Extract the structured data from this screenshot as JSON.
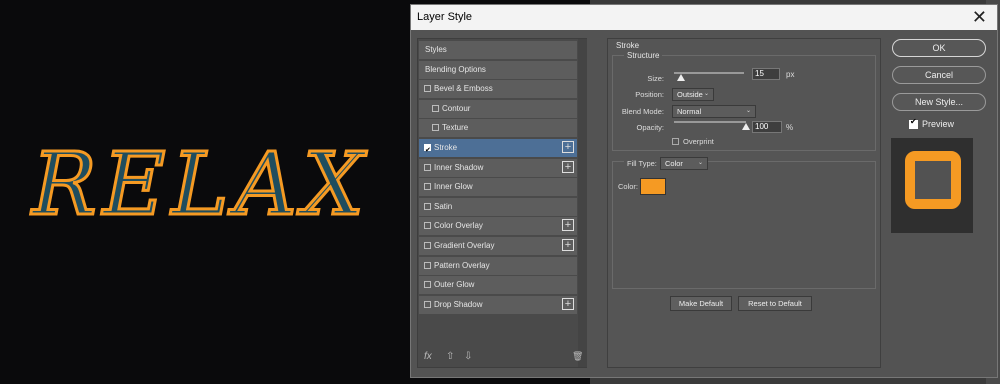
{
  "canvas": {
    "art_text": "RELAX",
    "colors": {
      "fill": "#1f4d5e",
      "stroke": "#f59a23",
      "background": "#0a0a0c"
    }
  },
  "dialog": {
    "title": "Layer Style",
    "close_glyph": "✕"
  },
  "styles_list": [
    {
      "label": "Styles",
      "checkbox": false,
      "plus": false,
      "selected": false,
      "indent": 0
    },
    {
      "label": "Blending Options",
      "checkbox": false,
      "plus": false,
      "selected": false,
      "indent": 0
    },
    {
      "label": "Bevel & Emboss",
      "checkbox": true,
      "checked": false,
      "plus": false,
      "selected": false,
      "indent": 0
    },
    {
      "label": "Contour",
      "checkbox": true,
      "checked": false,
      "plus": false,
      "selected": false,
      "indent": 1
    },
    {
      "label": "Texture",
      "checkbox": true,
      "checked": false,
      "plus": false,
      "selected": false,
      "indent": 1
    },
    {
      "label": "Stroke",
      "checkbox": true,
      "checked": true,
      "plus": true,
      "selected": true,
      "indent": 0
    },
    {
      "label": "Inner Shadow",
      "checkbox": true,
      "checked": false,
      "plus": true,
      "selected": false,
      "indent": 0
    },
    {
      "label": "Inner Glow",
      "checkbox": true,
      "checked": false,
      "plus": false,
      "selected": false,
      "indent": 0
    },
    {
      "label": "Satin",
      "checkbox": true,
      "checked": false,
      "plus": false,
      "selected": false,
      "indent": 0
    },
    {
      "label": "Color Overlay",
      "checkbox": true,
      "checked": false,
      "plus": true,
      "selected": false,
      "indent": 0
    },
    {
      "label": "Gradient Overlay",
      "checkbox": true,
      "checked": false,
      "plus": true,
      "selected": false,
      "indent": 0
    },
    {
      "label": "Pattern Overlay",
      "checkbox": true,
      "checked": false,
      "plus": false,
      "selected": false,
      "indent": 0
    },
    {
      "label": "Outer Glow",
      "checkbox": true,
      "checked": false,
      "plus": false,
      "selected": false,
      "indent": 0
    },
    {
      "label": "Drop Shadow",
      "checkbox": true,
      "checked": false,
      "plus": true,
      "selected": false,
      "indent": 0
    }
  ],
  "left_tools": {
    "fx": "fx",
    "up": "⇧",
    "down": "⇩",
    "trash": "🗑"
  },
  "stroke": {
    "heading": "Stroke",
    "structure_heading": "Structure",
    "size_label": "Size:",
    "size_value": "15",
    "size_unit": "px",
    "size_level": 0.1,
    "position_label": "Position:",
    "position_value": "Outside",
    "blend_label": "Blend Mode:",
    "blend_value": "Normal",
    "opacity_label": "Opacity:",
    "opacity_value": "100",
    "opacity_unit": "%",
    "opacity_level": 1.0,
    "overprint_label": "Overprint",
    "fill_type_label": "Fill Type:",
    "fill_type_value": "Color",
    "color_label": "Color:",
    "color_value": "#f59a23"
  },
  "footer_buttons": {
    "make_default": "Make Default",
    "reset_default": "Reset to Default"
  },
  "right_buttons": {
    "ok": "OK",
    "cancel": "Cancel",
    "new_style": "New Style...",
    "preview_label": "Preview",
    "preview_checked": true
  }
}
